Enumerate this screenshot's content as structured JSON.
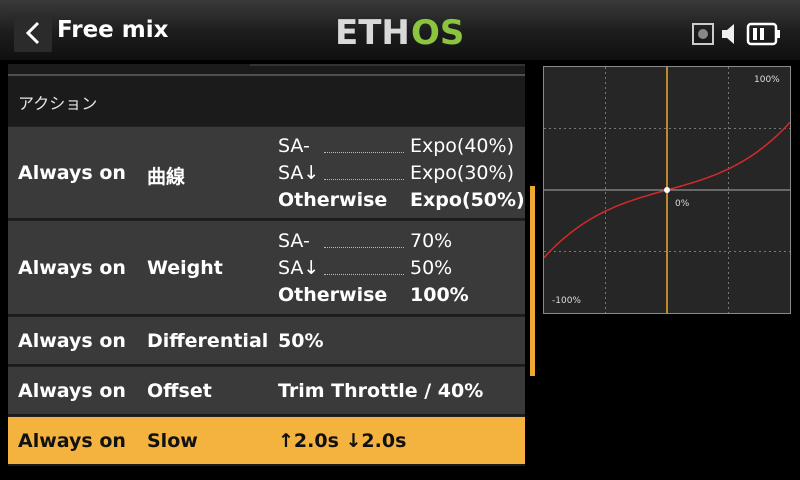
{
  "header": {
    "title": "Free mix",
    "logo_text": "ETHOS",
    "logo_colors": {
      "eth": "#d9d9d9",
      "os": "#8bc53f"
    }
  },
  "status_icons": [
    "record-icon",
    "speaker-icon",
    "battery-icon"
  ],
  "section": {
    "label": "アクション"
  },
  "rows": [
    {
      "trigger": "Always on",
      "action": "曲線",
      "conditions": [
        {
          "switch": "SA-",
          "value": "Expo(40%)"
        },
        {
          "switch": "SA↓",
          "value": "Expo(30%)"
        }
      ],
      "otherwise": {
        "label": "Otherwise",
        "value": "Expo(50%)"
      }
    },
    {
      "trigger": "Always on",
      "action": "Weight",
      "conditions": [
        {
          "switch": "SA-",
          "value": "70%"
        },
        {
          "switch": "SA↓",
          "value": "50%"
        }
      ],
      "otherwise": {
        "label": "Otherwise",
        "value": "100%"
      }
    },
    {
      "trigger": "Always on",
      "action": "Differential",
      "value": "50%"
    },
    {
      "trigger": "Always on",
      "action": "Offset",
      "value": "Trim Throttle / 40%"
    },
    {
      "trigger": "Always on",
      "action": "Slow",
      "value": "↑2.0s ↓2.0s",
      "selected": true
    }
  ],
  "graph": {
    "label_top_right": "100%",
    "label_center": "0%",
    "label_bottom_left": "-100%",
    "curve_color": "#d42a2a",
    "axis_color": "#f0a830",
    "expo_percent": 50
  },
  "colors": {
    "accent": "#f4b23f",
    "row_bg": "#3a3a3a",
    "panel_bg": "#1b1b1b"
  }
}
